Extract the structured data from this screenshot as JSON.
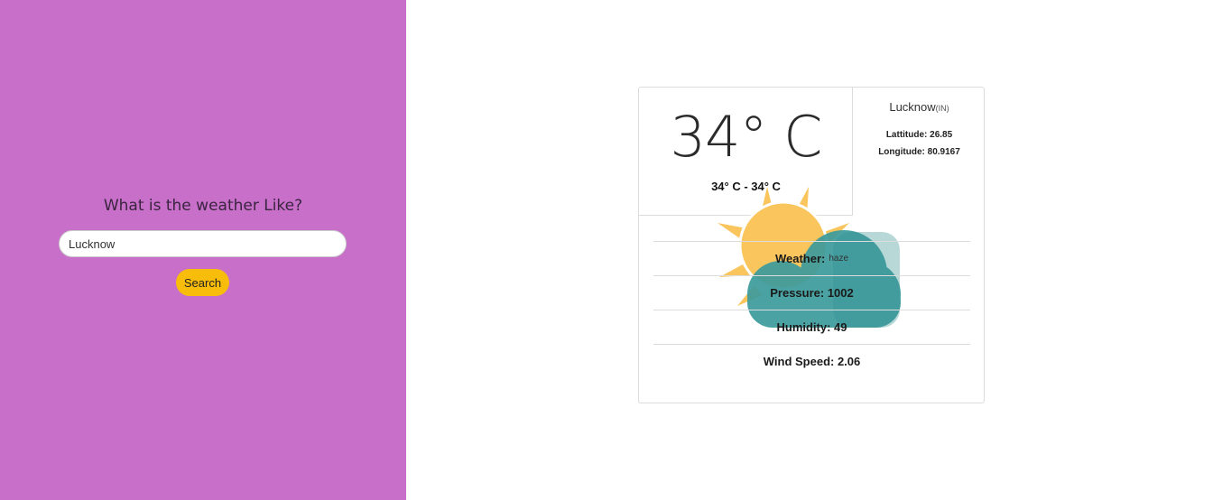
{
  "sidebar": {
    "heading": "What is the weather Like?",
    "search_value": "Lucknow",
    "search_button": "Search",
    "background": "#c76fc9",
    "button_color": "#f8bc0a"
  },
  "card": {
    "temp": "34° C",
    "temp_range": "34° C - 34° C",
    "city": "Lucknow",
    "country": "(IN)",
    "latitude": "Lattitude: 26.85",
    "longitude": "Longitude: 80.9167",
    "weather_label": "Weather:",
    "weather_value": "haze",
    "pressure": "Pressure: 1002",
    "humidity": "Humidity: 49",
    "wind_speed": "Wind Speed: 2.06",
    "icon": "partly-cloudy-icon",
    "sun_color": "#f9c55c",
    "cloud_color": "#3c9b9c"
  }
}
